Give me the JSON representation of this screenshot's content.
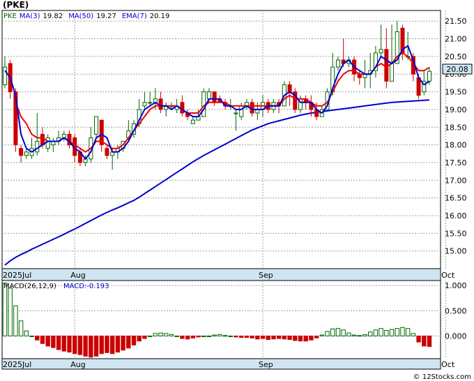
{
  "chart_data": [
    {
      "type": "candlestick",
      "title": "(PKE)",
      "legend": [
        {
          "text": "PKE",
          "color": "#006600"
        },
        {
          "text": "MA(3)",
          "value": "19.82",
          "color": "#0000cc"
        },
        {
          "text": "MA(50)",
          "value": "19.27",
          "color": "#0000cc"
        },
        {
          "text": "EMA(7)",
          "value": "20.19",
          "color": "#0000cc"
        }
      ],
      "ylim": [
        14.5,
        21.8
      ],
      "yticks": [
        "21.50",
        "21.00",
        "20.50",
        "20.00",
        "19.50",
        "19.00",
        "18.50",
        "18.00",
        "17.50",
        "17.00",
        "16.50",
        "16.00",
        "15.50",
        "15.00"
      ],
      "ytick_values": [
        21.5,
        21.0,
        20.5,
        20.0,
        19.5,
        19.0,
        18.5,
        18.0,
        17.5,
        17.0,
        16.5,
        16.0,
        15.5,
        15.0
      ],
      "last_price": "20.08",
      "x_labels": [
        {
          "label": "2025Jul",
          "index": 0
        },
        {
          "label": "Aug",
          "index": 13
        },
        {
          "label": "Sep",
          "index": 48
        },
        {
          "label": "Oct",
          "index": 82
        }
      ],
      "candles": [
        [
          19.7,
          20.2,
          20.5,
          19.6
        ],
        [
          20.3,
          19.5,
          20.4,
          19.3
        ],
        [
          19.5,
          18.0,
          19.6,
          17.8
        ],
        [
          17.9,
          17.7,
          18.0,
          17.5
        ],
        [
          17.7,
          17.8,
          17.9,
          17.6
        ],
        [
          17.7,
          17.9,
          18.2,
          17.6
        ],
        [
          17.8,
          18.1,
          18.9,
          17.7
        ],
        [
          18.3,
          18.0,
          18.5,
          17.9
        ],
        [
          17.9,
          18.2,
          18.3,
          17.8
        ],
        [
          18.0,
          18.1,
          18.2,
          17.8
        ],
        [
          18.1,
          18.2,
          18.4,
          18.0
        ],
        [
          18.2,
          18.3,
          18.4,
          18.1
        ],
        [
          18.3,
          18.0,
          18.4,
          17.9
        ],
        [
          18.2,
          17.7,
          18.3,
          17.5
        ],
        [
          17.8,
          17.5,
          17.9,
          17.4
        ],
        [
          17.5,
          17.6,
          17.7,
          17.4
        ],
        [
          17.6,
          18.2,
          18.5,
          17.5
        ],
        [
          18.3,
          18.8,
          18.8,
          18.2
        ],
        [
          18.7,
          18.0,
          18.7,
          17.8
        ],
        [
          17.9,
          17.7,
          18.0,
          17.6
        ],
        [
          17.7,
          17.8,
          17.9,
          17.3
        ],
        [
          17.8,
          17.9,
          18.0,
          17.6
        ],
        [
          17.9,
          18.1,
          18.1,
          17.8
        ],
        [
          18.2,
          18.4,
          18.7,
          18.1
        ],
        [
          18.3,
          18.6,
          18.7,
          18.2
        ],
        [
          18.6,
          19.0,
          19.3,
          18.5
        ],
        [
          19.1,
          19.2,
          19.5,
          19.0
        ],
        [
          19.2,
          19.2,
          19.5,
          19.1
        ],
        [
          19.2,
          19.3,
          19.6,
          19.0
        ],
        [
          19.3,
          19.0,
          19.5,
          18.9
        ],
        [
          19.0,
          19.1,
          19.2,
          18.8
        ],
        [
          19.1,
          19.1,
          19.2,
          19.0
        ],
        [
          19.0,
          19.1,
          19.3,
          18.9
        ],
        [
          19.2,
          18.9,
          19.4,
          18.8
        ],
        [
          18.9,
          18.8,
          19.0,
          18.7
        ],
        [
          18.6,
          18.7,
          18.8,
          18.6
        ],
        [
          18.7,
          18.8,
          19.0,
          18.7
        ],
        [
          18.8,
          19.5,
          19.6,
          18.8
        ],
        [
          19.3,
          19.5,
          19.6,
          19.2
        ],
        [
          19.5,
          19.2,
          19.5,
          19.1
        ],
        [
          19.3,
          19.2,
          19.4,
          19.2
        ],
        [
          19.2,
          19.1,
          19.3,
          19.0
        ],
        [
          19.1,
          19.1,
          19.3,
          19.0
        ],
        [
          18.9,
          18.9,
          19.0,
          18.4
        ],
        [
          18.8,
          19.1,
          19.2,
          18.7
        ],
        [
          19.1,
          19.2,
          19.3,
          19.0
        ],
        [
          19.2,
          18.9,
          19.3,
          18.8
        ],
        [
          18.9,
          19.0,
          19.2,
          18.7
        ],
        [
          19.0,
          19.2,
          19.4,
          18.8
        ],
        [
          19.2,
          19.0,
          19.3,
          18.9
        ],
        [
          19.0,
          19.2,
          19.3,
          18.9
        ],
        [
          19.2,
          19.1,
          19.3,
          18.9
        ],
        [
          19.1,
          19.7,
          19.8,
          19.1
        ],
        [
          19.7,
          19.5,
          19.8,
          19.1
        ],
        [
          19.5,
          19.0,
          19.6,
          18.9
        ],
        [
          19.0,
          19.3,
          19.4,
          18.9
        ],
        [
          19.3,
          19.2,
          19.4,
          19.0
        ],
        [
          19.2,
          19.0,
          19.4,
          18.8
        ],
        [
          19.0,
          18.8,
          19.2,
          18.7
        ],
        [
          18.8,
          19.0,
          19.1,
          18.8
        ],
        [
          19.0,
          19.5,
          19.6,
          19.0
        ],
        [
          19.5,
          20.2,
          20.6,
          19.4
        ],
        [
          20.2,
          20.4,
          20.5,
          20.1
        ],
        [
          20.4,
          20.3,
          21.0,
          20.2
        ],
        [
          20.3,
          20.4,
          20.5,
          20.2
        ],
        [
          20.4,
          20.0,
          20.5,
          19.8
        ],
        [
          20.0,
          19.9,
          20.1,
          19.7
        ],
        [
          19.9,
          20.0,
          20.4,
          19.6
        ],
        [
          20.0,
          20.1,
          20.6,
          19.6
        ],
        [
          20.1,
          20.6,
          20.8,
          19.9
        ],
        [
          20.6,
          20.7,
          21.4,
          20.5
        ],
        [
          20.7,
          19.8,
          21.3,
          19.6
        ],
        [
          19.8,
          20.3,
          21.4,
          20.1
        ],
        [
          20.3,
          21.2,
          21.5,
          20.7
        ],
        [
          21.3,
          20.6,
          21.4,
          20.4
        ],
        [
          20.5,
          20.5,
          21.2,
          20.4
        ],
        [
          20.5,
          20.0,
          20.6,
          19.8
        ],
        [
          19.9,
          19.4,
          20.0,
          19.3
        ],
        [
          19.5,
          19.8,
          20.1,
          19.4
        ],
        [
          19.8,
          20.08,
          20.2,
          19.7
        ]
      ],
      "ma3": [
        20.1,
        19.9,
        19.4,
        18.3,
        17.9,
        17.8,
        17.9,
        18.0,
        18.1,
        18.1,
        18.1,
        18.2,
        18.1,
        17.9,
        17.8,
        17.6,
        17.8,
        18.2,
        18.3,
        18.2,
        17.8,
        17.8,
        17.9,
        18.1,
        18.4,
        18.7,
        19.0,
        19.1,
        19.2,
        19.1,
        19.1,
        19.0,
        19.1,
        19.0,
        18.9,
        18.8,
        18.8,
        19.0,
        19.3,
        19.3,
        19.3,
        19.1,
        19.1,
        19.0,
        19.0,
        19.1,
        19.0,
        19.0,
        19.0,
        19.1,
        19.1,
        19.1,
        19.4,
        19.5,
        19.4,
        19.2,
        19.2,
        19.2,
        19.0,
        18.9,
        19.1,
        19.6,
        20.0,
        20.3,
        20.4,
        20.2,
        20.1,
        20.0,
        20.0,
        20.2,
        20.5,
        20.4,
        20.3,
        20.4,
        20.7,
        20.8,
        20.4,
        19.9,
        19.7,
        19.8
      ],
      "ema7": [
        null,
        null,
        19.2,
        18.8,
        18.6,
        18.3,
        18.2,
        18.2,
        18.1,
        18.1,
        18.1,
        18.2,
        18.1,
        18.0,
        17.9,
        17.8,
        17.9,
        18.1,
        18.1,
        18.0,
        17.9,
        17.9,
        18.0,
        18.2,
        18.4,
        18.6,
        18.8,
        19.0,
        19.1,
        19.1,
        19.1,
        19.1,
        19.1,
        19.0,
        18.9,
        18.9,
        18.9,
        19.1,
        19.2,
        19.2,
        19.2,
        19.2,
        19.1,
        19.1,
        19.1,
        19.1,
        19.1,
        19.1,
        19.1,
        19.1,
        19.1,
        19.1,
        19.3,
        19.4,
        19.3,
        19.3,
        19.3,
        19.2,
        19.1,
        19.1,
        19.2,
        19.5,
        19.8,
        20.0,
        20.1,
        20.1,
        20.0,
        20.0,
        20.0,
        20.2,
        20.3,
        20.2,
        20.3,
        20.5,
        20.6,
        20.5,
        20.3,
        20.1,
        20.1,
        20.19
      ],
      "ma50": [
        18.45,
        18.55,
        18.65,
        18.75,
        18.85,
        18.95
      ],
      "ma50_full": [
        14.6,
        14.72,
        14.82,
        14.9,
        14.97,
        15.05,
        15.12,
        15.19,
        15.26,
        15.33,
        15.4,
        15.47,
        15.55,
        15.62,
        15.7,
        15.78,
        15.86,
        15.94,
        16.02,
        16.09,
        16.16,
        16.22,
        16.29,
        16.36,
        16.43,
        16.52,
        16.62,
        16.72,
        16.82,
        16.92,
        17.02,
        17.12,
        17.22,
        17.32,
        17.42,
        17.52,
        17.61,
        17.7,
        17.78,
        17.86,
        17.94,
        18.02,
        18.1,
        18.18,
        18.26,
        18.34,
        18.42,
        18.48,
        18.54,
        18.6,
        18.64,
        18.68,
        18.72,
        18.76,
        18.8,
        18.84,
        18.87,
        18.9,
        18.92,
        18.94,
        18.96,
        18.98,
        19.0,
        19.02,
        19.04,
        19.06,
        19.08,
        19.1,
        19.12,
        19.14,
        19.16,
        19.18,
        19.2,
        19.21,
        19.22,
        19.23,
        19.24,
        19.25,
        19.26,
        19.27
      ]
    },
    {
      "type": "bar",
      "title": "MACD(26,12,9)",
      "legend": [
        {
          "text": "MACD(26,12,9)",
          "color": "#000000"
        },
        {
          "text": "MACD:-0.193",
          "color": "#0000cc"
        }
      ],
      "ylim": [
        -0.45,
        1.1
      ],
      "yticks": [
        "1.000",
        "0.500",
        "0.000"
      ],
      "ytick_values": [
        1.0,
        0.5,
        0.0
      ],
      "x_labels": [
        {
          "label": "2025Jul",
          "index": 0
        },
        {
          "label": "Aug",
          "index": 13
        },
        {
          "label": "Sep",
          "index": 48
        },
        {
          "label": "Oct",
          "index": 82
        }
      ],
      "values": [
        1.05,
        0.95,
        0.6,
        0.3,
        0.1,
        0.0,
        -0.08,
        -0.15,
        -0.2,
        -0.23,
        -0.27,
        -0.3,
        -0.32,
        -0.35,
        -0.37,
        -0.4,
        -0.42,
        -0.4,
        -0.35,
        -0.33,
        -0.35,
        -0.32,
        -0.28,
        -0.24,
        -0.18,
        -0.1,
        -0.05,
        0.0,
        0.05,
        0.06,
        0.05,
        0.03,
        0.0,
        -0.05,
        -0.06,
        -0.04,
        -0.02,
        0.0,
        0.0,
        0.02,
        0.03,
        0.01,
        0.0,
        -0.02,
        -0.03,
        -0.03,
        -0.04,
        -0.06,
        -0.05,
        -0.07,
        -0.06,
        -0.05,
        -0.06,
        -0.07,
        -0.09,
        -0.1,
        -0.1,
        -0.08,
        -0.04,
        0.02,
        0.09,
        0.14,
        0.15,
        0.12,
        0.06,
        0.02,
        0.01,
        0.03,
        0.08,
        0.12,
        0.15,
        0.11,
        0.13,
        0.15,
        0.17,
        0.15,
        0.05,
        -0.12,
        -0.2,
        -0.21
      ],
      "color_positive": "#006600",
      "color_negative": "#cc0000"
    }
  ],
  "watermark": "© 12Stocks.com",
  "colors": {
    "up": "#006600",
    "down": "#cc0000",
    "ma": "#0000cc",
    "ema": "#ee0000",
    "axis_band": "#cfe5f2",
    "grid": "#999999",
    "last_price_box": "#cfe5f2"
  }
}
